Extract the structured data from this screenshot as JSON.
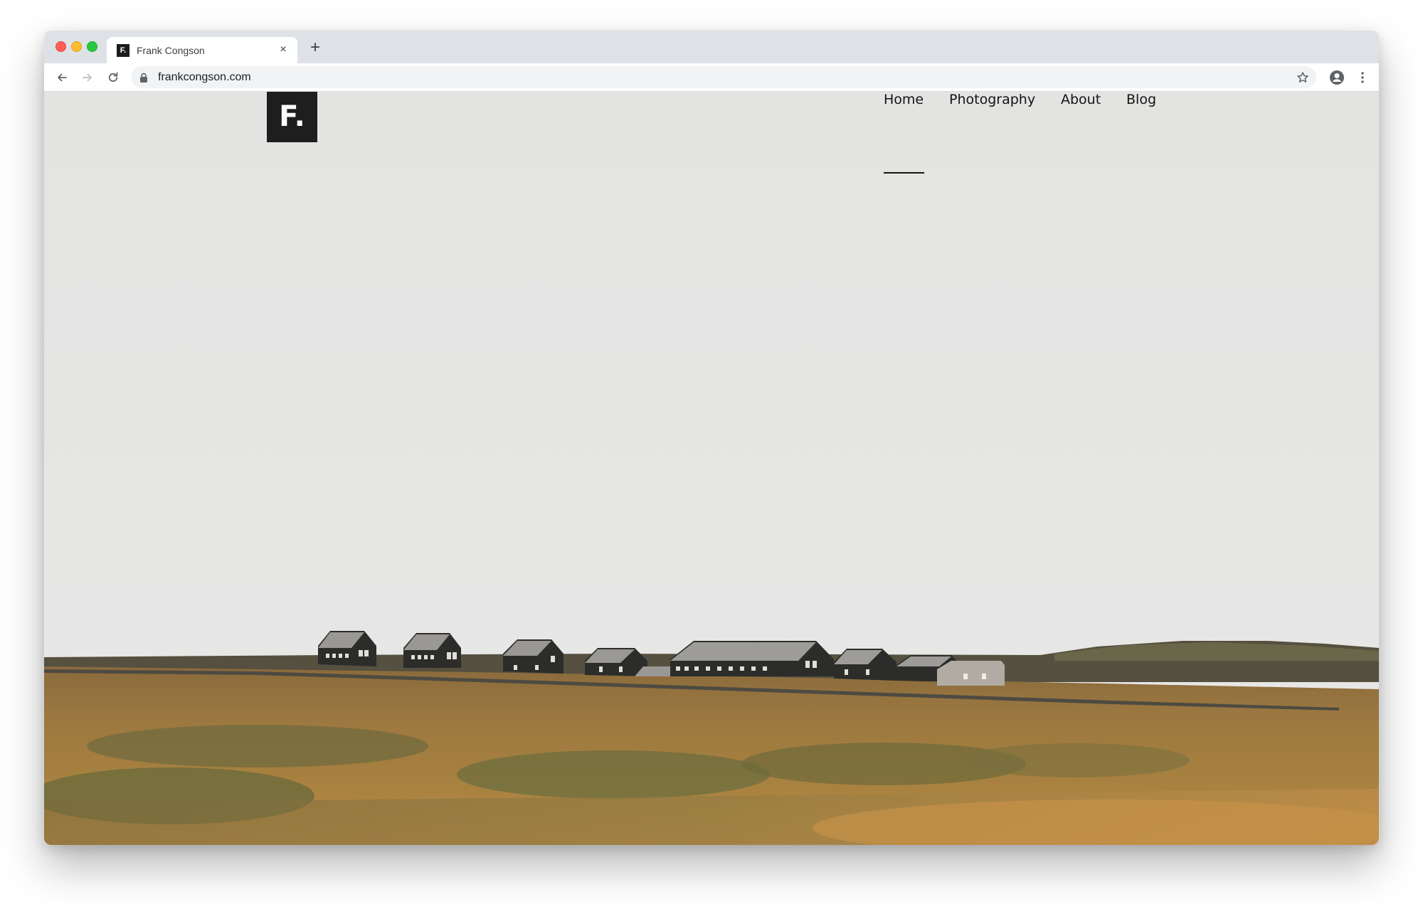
{
  "browser": {
    "tab": {
      "favicon_text": "F.",
      "title": "Frank Congson",
      "close_glyph": "×"
    },
    "new_tab_glyph": "+",
    "address_bar": {
      "url": "frankcongson.com"
    }
  },
  "site": {
    "logo_text": "F.",
    "nav": {
      "items": [
        {
          "label": "Home",
          "active": true
        },
        {
          "label": "Photography",
          "active": false
        },
        {
          "label": "About",
          "active": false
        },
        {
          "label": "Blog",
          "active": false
        }
      ]
    }
  },
  "colors": {
    "sky": "#e4e4e3",
    "grass": "#a97b3d",
    "logo_bg": "#1e1e1e",
    "tabstrip": "#dee1e6"
  }
}
